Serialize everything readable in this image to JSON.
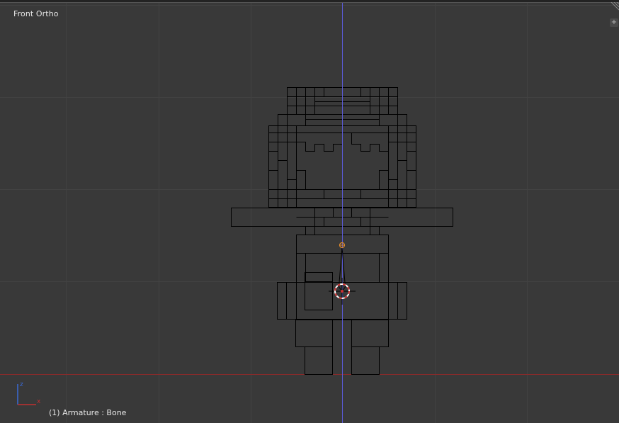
{
  "viewport": {
    "view_name": "Front Ortho",
    "status_text": "(1) Armature : Bone",
    "corner_widget_icon": "plus-icon"
  },
  "axis_gizmo": {
    "z_label": "z",
    "x_label": "x"
  },
  "colors": {
    "background": "#393939",
    "grid": "#424242",
    "x_axis_line": "#8a2a2a",
    "z_axis_line": "#5a5ad6",
    "wireframe": "#000000",
    "bone_selected": "#e08a2c",
    "cursor_red": "#d03030",
    "cursor_white": "#ffffff"
  }
}
